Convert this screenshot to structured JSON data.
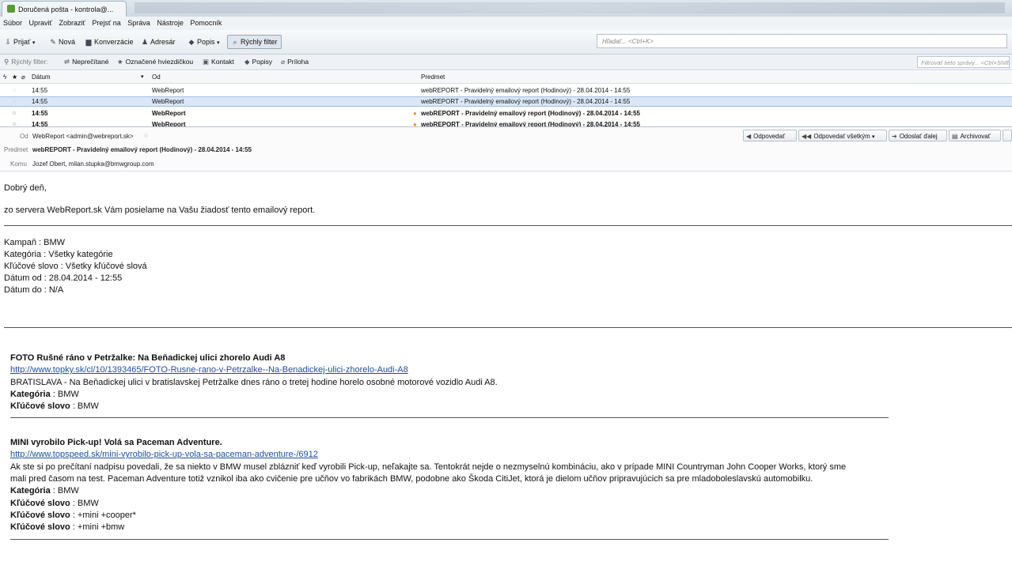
{
  "tab": {
    "title": "Doručená pošta - kontrola@..."
  },
  "menu": [
    "Súbor",
    "Upraviť",
    "Zobraziť",
    "Prejsť na",
    "Správa",
    "Nástroje",
    "Pomocník"
  ],
  "toolbar": {
    "get_mail": "Prijať",
    "write": "Nová",
    "chat": "Konverzácie",
    "address_book": "Adresár",
    "tags": "Popis",
    "quick_filter": "Rýchly filter",
    "search_placeholder": "Hľadať... <Ctrl+K>"
  },
  "quickfilter": {
    "label": "Rýchly filter:",
    "unread": "Neprečítané",
    "starred": "Označené hviezdičkou",
    "contact": "Kontakt",
    "tags": "Popisy",
    "attachment": "Príloha",
    "filter_placeholder": "Filtrovať tieto správy... <Ctrl+Shift+K>"
  },
  "list": {
    "columns": {
      "date": "Dátum",
      "from": "Od",
      "subject": "Predmet"
    },
    "rows": [
      {
        "time": "14:55",
        "from": "WebReport",
        "subject": "webREPORT - Pravidelný emailový report (Hodinový)  - 28.04.2014 - 14:55",
        "bold": false,
        "selected": false
      },
      {
        "time": "14:55",
        "from": "WebReport",
        "subject": "webREPORT - Pravidelný emailový report (Hodinový)  - 28.04.2014 - 14:55",
        "bold": false,
        "selected": true
      },
      {
        "time": "14:55",
        "from": "WebReport",
        "subject": "webREPORT - Pravidelný emailový report (Hodinový)  - 28.04.2014 - 14:55",
        "bold": true,
        "selected": false
      },
      {
        "time": "14:55",
        "from": "WebReport",
        "subject": "webREPORT - Pravidelný emailový report (Hodinový)  - 28.04.2014 - 14:55",
        "bold": true,
        "selected": false
      }
    ]
  },
  "header": {
    "from_label": "Od",
    "from_value": "WebReport <admin@webreport.sk>",
    "subject_label": "Predmet",
    "subject_value": "webREPORT - Pravidelný emailový report (Hodinový) - 28.04.2014 - 14:55",
    "to_label": "Komu",
    "to_value": "Jozef Obert, milan.stupka@bmwgroup.com",
    "reply": "Odpovedať",
    "reply_all": "Odpovedať všetkým",
    "forward": "Odoslať ďalej",
    "archive": "Archivovať"
  },
  "body": {
    "greeting": "Dobrý deň,",
    "intro": "zo servera WebReport.sk Vám posielame na Vašu žiadosť tento emailový report.",
    "meta": [
      "Kampaň : BMW",
      "Kategória : Všetky kategórie",
      "Kľúčové slovo : Všetky kľúčové slová",
      "Dátum od : 28.04.2014 - 12:55",
      "Dátum do : N/A"
    ],
    "articles": [
      {
        "title": "FOTO Rušné ráno v Petržalke: Na Beňadickej ulici zhorelo Audi A8",
        "url": "http://www.topky.sk/cl/10/1393465/FOTO-Rusne-rano-v-Petrzalke--Na-Benadickej-ulici-zhorelo-Audi-A8",
        "text": [
          "BRATISLAVA - Na Beňadickej ulici v bratislavskej Petržalke dnes ráno o tretej hodine horelo osobné motorové vozidlo Audi A8."
        ],
        "fields": [
          {
            "key": "Kategória",
            "value": " : BMW"
          },
          {
            "key": "Kľúčové slovo",
            "value": " : BMW"
          }
        ]
      },
      {
        "title": "MINI vyrobilo Pick-up! Volá sa Paceman Adventure.",
        "url": "http://www.topspeed.sk/mini-vyrobilo-pick-up-vola-sa-paceman-adventure-/6912",
        "text": [
          "Ak ste si po prečítaní nadpisu povedali, že sa niekto v BMW musel zblázniť keď vyrobili Pick-up, neľakajte sa. Tentokrát nejde o nezmyselnú kombináciu, ako v prípade MINI Countryman John Cooper Works, ktorý sme",
          "mali pred časom na test. Paceman Adventure totiž vznikol iba ako cvičenie pre učňov vo fabrikách BMW, podobne ako Škoda CitiJet, ktorá je dielom učňov pripravujúcich sa pre mladoboleslavskú automobilku."
        ],
        "fields": [
          {
            "key": "Kategória",
            "value": " : BMW"
          },
          {
            "key": "Kľúčové slovo",
            "value": " : BMW"
          },
          {
            "key": "Kľúčové slovo",
            "value": " : +mini +cooper*"
          },
          {
            "key": "Kľúčové slovo",
            "value": " : +mini +bmw"
          }
        ]
      }
    ]
  }
}
